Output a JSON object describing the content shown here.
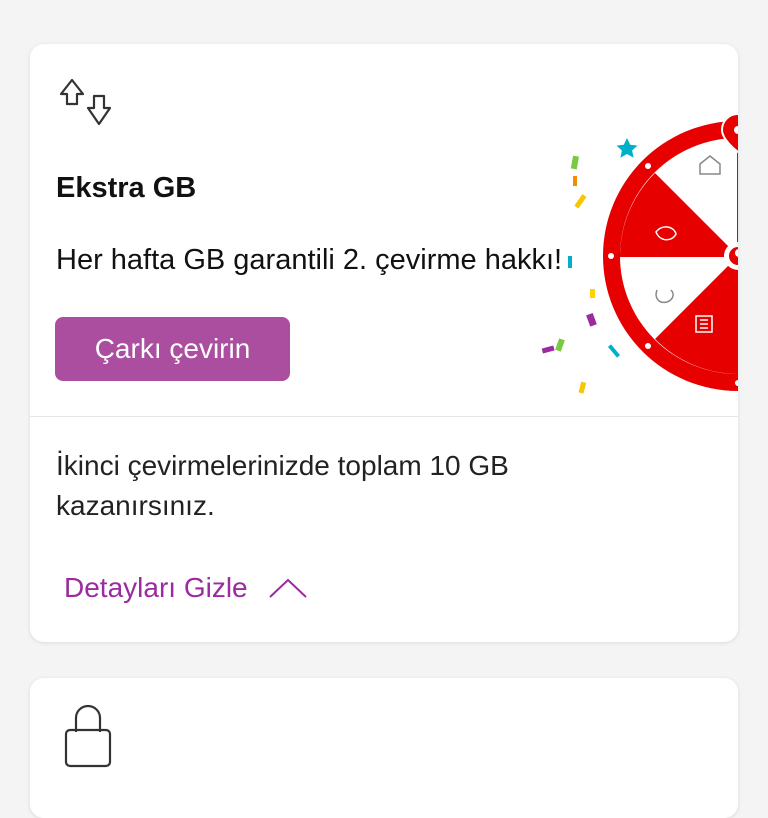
{
  "offer_card": {
    "icon": "data-transfer-arrows-icon",
    "title": "Ekstra GB",
    "description": "Her hafta GB garantili 2. çevirme hakkı!",
    "cta_label": "Çarkı çevirin",
    "cta_color": "#ab4e9f",
    "illustration": "prize-wheel-with-confetti",
    "details_text": "İkinci çevirmelerinizde toplam 10 GB kazanırsınız.",
    "toggle_label": "Detayları Gizle",
    "toggle_icon": "chevron-up-icon",
    "link_color": "#9c2aa0",
    "wheel_red": "#e60000"
  },
  "next_card": {
    "icon": "shopping-bag-icon"
  }
}
